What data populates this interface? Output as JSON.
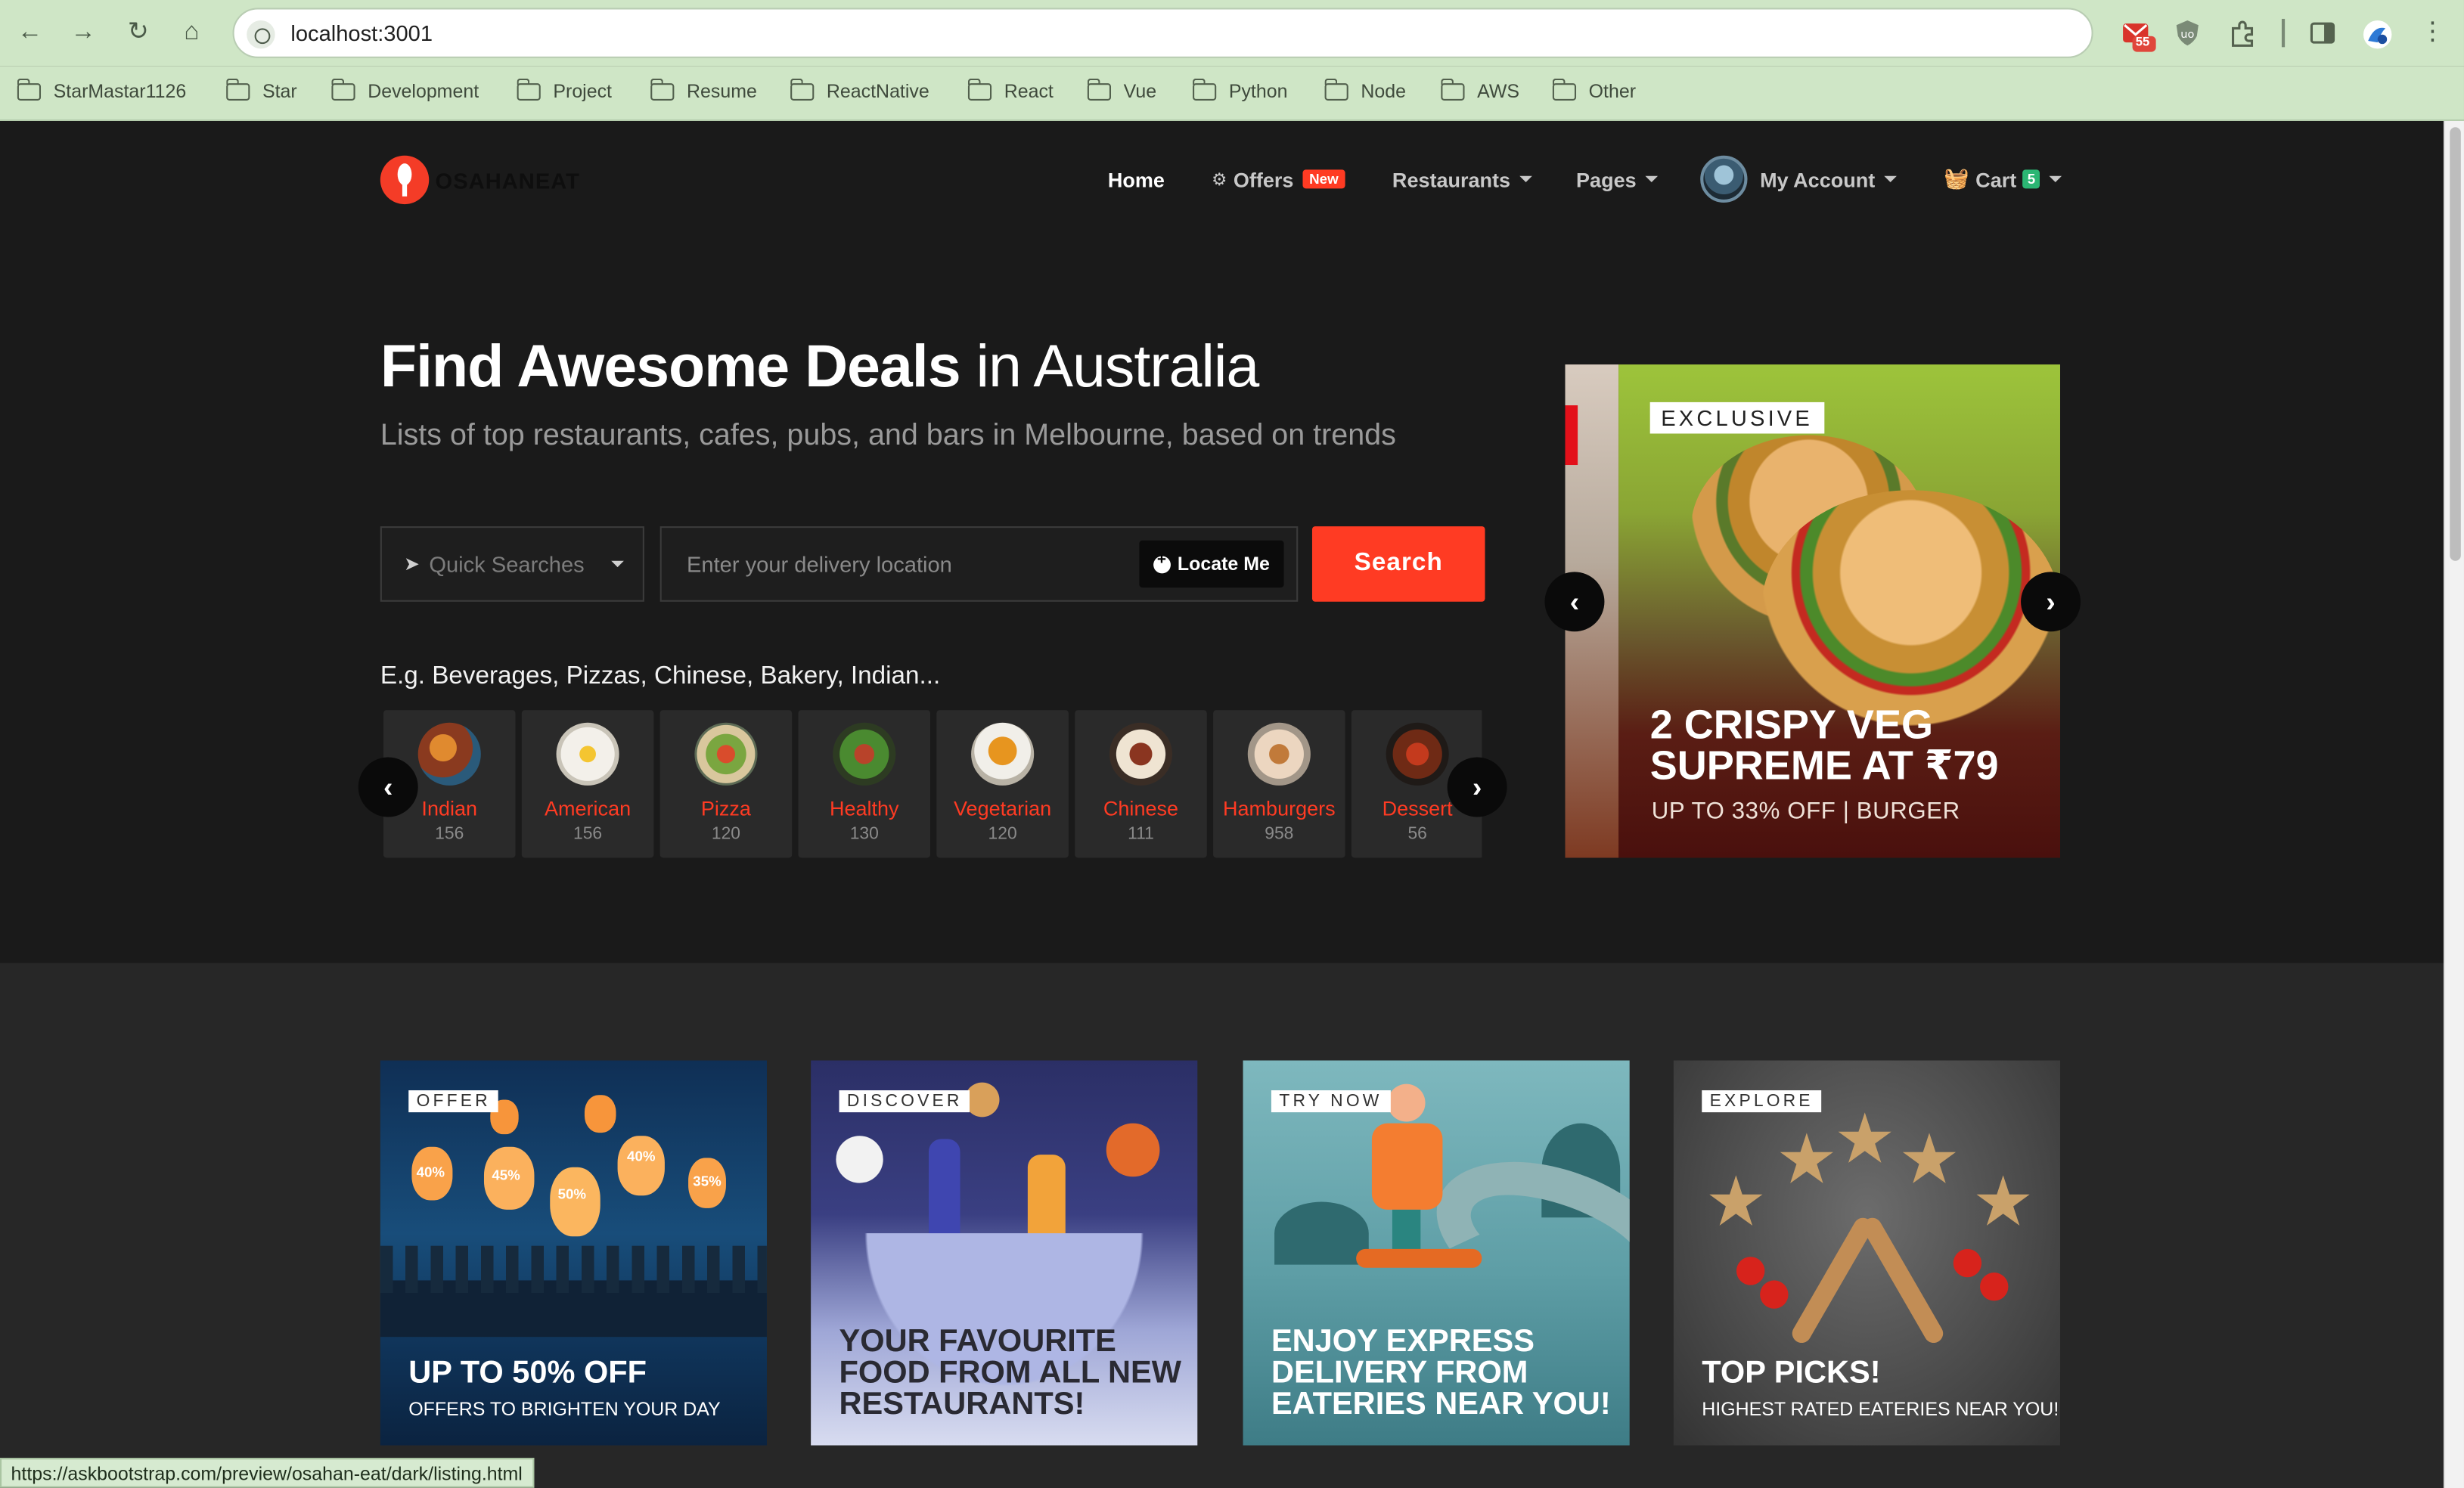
{
  "browser": {
    "url": "localhost:3001",
    "mail_badge": "55",
    "bookmarks": [
      "StarMastar1126",
      "Star",
      "Development",
      "Project",
      "Resume",
      "ReactNative",
      "React",
      "Vue",
      "Python",
      "Node",
      "AWS",
      "Other"
    ]
  },
  "nav": {
    "logo_text": "OSAHANEAT",
    "home": "Home",
    "offers": "Offers",
    "offers_badge": "New",
    "restaurants": "Restaurants",
    "pages": "Pages",
    "account": "My Account",
    "cart": "Cart",
    "cart_badge": "5"
  },
  "hero": {
    "title_bold": "Find Awesome Deals",
    "title_light": " in Australia",
    "subtitle": "Lists of top restaurants, cafes, pubs, and bars in Melbourne, based on trends",
    "quick_searches": "Quick Searches",
    "location_placeholder": "Enter your delivery location",
    "locate_label": "Locate Me",
    "search_label": "Search",
    "examples": "E.g. Beverages, Pizzas, Chinese, Bakery, Indian..."
  },
  "categories": [
    {
      "name": "Indian",
      "count": "156"
    },
    {
      "name": "American",
      "count": "156"
    },
    {
      "name": "Pizza",
      "count": "120"
    },
    {
      "name": "Healthy",
      "count": "130"
    },
    {
      "name": "Vegetarian",
      "count": "120"
    },
    {
      "name": "Chinese",
      "count": "111"
    },
    {
      "name": "Hamburgers",
      "count": "958"
    },
    {
      "name": "Dessert",
      "count": "56"
    }
  ],
  "promo": {
    "tag": "EXCLUSIVE",
    "headline": "2 CRISPY VEG SUPREME AT ₹79",
    "sub": "UP TO 33% OFF | BURGER"
  },
  "cards": [
    {
      "tag": "OFFER",
      "title": "UP TO 50% OFF",
      "desc": "OFFERS TO BRIGHTEN YOUR DAY",
      "pct": [
        "40%",
        "45%",
        "50%",
        "40%",
        "35%"
      ]
    },
    {
      "tag": "DISCOVER",
      "title": "YOUR FAVOURITE FOOD FROM ALL NEW RESTAURANTS!",
      "desc": ""
    },
    {
      "tag": "TRY NOW",
      "title": "ENJOY EXPRESS DELIVERY FROM EATERIES NEAR YOU!",
      "desc": ""
    },
    {
      "tag": "EXPLORE",
      "title": "TOP PICKS!",
      "desc": "HIGHEST RATED EATERIES NEAR YOU!"
    }
  ],
  "status_url": "https://askbootstrap.com/preview/osahan-eat/dark/listing.html"
}
